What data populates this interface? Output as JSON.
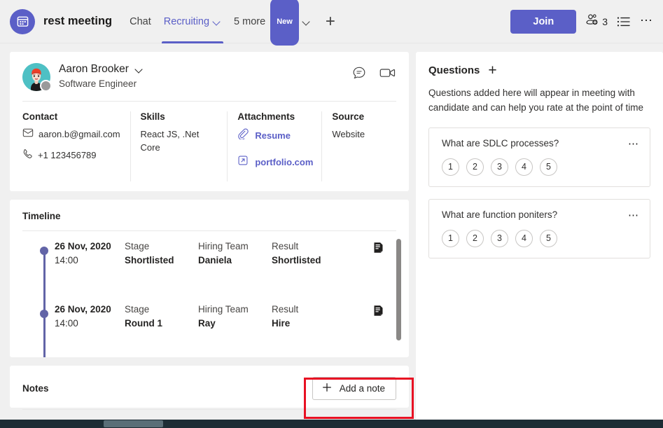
{
  "appbar": {
    "logo_icon": "calendar-grid-icon",
    "title": "rest meeting",
    "tabs": [
      {
        "label": "Chat",
        "has_chevron": false,
        "active": false
      },
      {
        "label": "Recruiting",
        "has_chevron": true,
        "active": true
      }
    ],
    "more_tabs_label": "5 more",
    "new_badge": "New",
    "add_tab_label": "+",
    "join_label": "Join",
    "people_count": "3",
    "people_icon": "add-people-icon",
    "list_icon": "list-icon",
    "overflow_icon": "ellipsis-icon"
  },
  "candidate": {
    "avatar_icon": "avatar-illustration",
    "presence_status": "away",
    "name": "Aaron Brooker",
    "name_chevron_icon": "chevron-down-icon",
    "role": "Software Engineer",
    "chat_icon": "chat-bubble-icon",
    "video_icon": "video-camera-icon",
    "contact": {
      "heading": "Contact",
      "email_icon": "envelope-icon",
      "email": "aaron.b@gmail.com",
      "phone_icon": "phone-icon",
      "phone": "+1 123456789"
    },
    "skills": {
      "heading": "Skills",
      "value": "React JS, .Net Core"
    },
    "attachments": {
      "heading": "Attachments",
      "items": [
        {
          "label": "Resume",
          "icon": "paperclip-icon"
        },
        {
          "label": "portfolio.com",
          "icon": "external-link-icon"
        }
      ]
    },
    "source": {
      "heading": "Source",
      "value": "Website"
    }
  },
  "timeline": {
    "heading": "Timeline",
    "labels": {
      "stage": "Stage",
      "team": "Hiring Team",
      "result": "Result"
    },
    "note_icon": "note-document-icon",
    "items": [
      {
        "date": "26 Nov, 2020",
        "time": "14:00",
        "stage_label": "Stage",
        "stage": "Shortlisted",
        "team_label": "Hiring Team",
        "team": "Daniela",
        "result_label": "Result",
        "result": "Shortlisted"
      },
      {
        "date": "26 Nov, 2020",
        "time": "14:00",
        "stage_label": "Stage",
        "stage": "Round 1",
        "team_label": "Hiring Team",
        "team": "Ray",
        "result_label": "Result",
        "result": "Hire"
      }
    ]
  },
  "notes": {
    "heading": "Notes",
    "add_button_label": "Add a note",
    "add_button_icon": "plus-icon",
    "highlight_color": "#e81123"
  },
  "questions": {
    "title": "Questions",
    "add_icon": "plus-icon",
    "description": "Questions added here will appear in meeting with candidate and can help you rate at the point of time",
    "more_icon": "ellipsis-icon",
    "rating_scale": [
      "1",
      "2",
      "3",
      "4",
      "5"
    ],
    "items": [
      {
        "text": "What are SDLC processes?"
      },
      {
        "text": "What are function poniters?"
      }
    ]
  },
  "theme": {
    "accent": "#5b5fc7",
    "timeline_accent": "#6264a7",
    "page_bg": "#f0f0f0",
    "card_bg": "#ffffff",
    "scrollbar_dark": "#1d2d35"
  }
}
